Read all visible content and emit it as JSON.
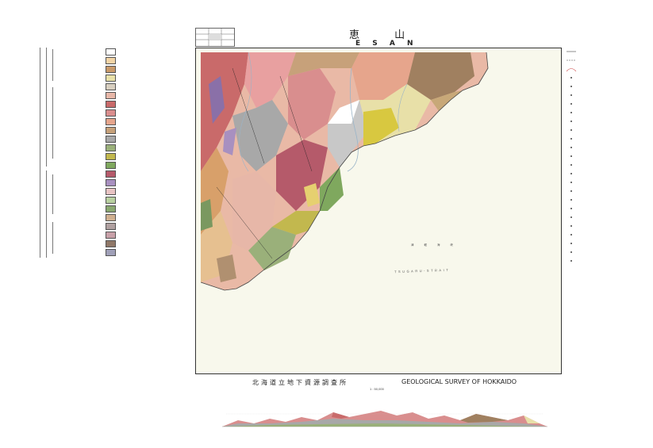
{
  "map": {
    "title_kanji": "恵 山",
    "title_roman": "E S A N",
    "survey_jp": "北海道立地下資源調査所",
    "survey_en": "GEOLOGICAL SURVEY OF HOKKAIDO",
    "scale": "1 : 50,000",
    "strait_label": "TSUGARU-STRAIT",
    "sea_label": "津 軽 海 峡"
  },
  "legend": {
    "items": [
      {
        "name": "",
        "color": "#ffffff"
      },
      {
        "name": "",
        "color": "#f2d4a6"
      },
      {
        "name": "",
        "color": "#c99a6a"
      },
      {
        "name": "",
        "color": "#e8e0a8"
      },
      {
        "name": "",
        "color": "#d8cfc0"
      },
      {
        "name": "",
        "color": "#e7b7a8"
      },
      {
        "name": "",
        "color": "#c96a6a"
      },
      {
        "name": "",
        "color": "#d98e8e"
      },
      {
        "name": "",
        "color": "#e6a58c"
      },
      {
        "name": "",
        "color": "#c7a17a"
      },
      {
        "name": "",
        "color": "#a8a8a8"
      },
      {
        "name": "",
        "color": "#9ab07a"
      },
      {
        "name": "",
        "color": "#c2b84e"
      },
      {
        "name": "",
        "color": "#7fa85e"
      },
      {
        "name": "",
        "color": "#b55a6a"
      },
      {
        "name": "",
        "color": "#a890c0"
      },
      {
        "name": "",
        "color": "#e9c4c4"
      },
      {
        "name": "",
        "color": "#b8d0a0"
      },
      {
        "name": "",
        "color": "#8aa870"
      },
      {
        "name": "",
        "color": "#d0b090"
      },
      {
        "name": "",
        "color": "#b0a0a0"
      },
      {
        "name": "",
        "color": "#c8a0a8"
      },
      {
        "name": "",
        "color": "#907868"
      },
      {
        "name": "",
        "color": "#a0a0b8"
      }
    ]
  },
  "right_legend": {
    "items": [
      {
        "sym": "line"
      },
      {
        "sym": "dash"
      },
      {
        "sym": "curve"
      },
      {
        "sym": "dot"
      },
      {
        "sym": "dot"
      },
      {
        "sym": "dot"
      },
      {
        "sym": "dot"
      },
      {
        "sym": "dot"
      },
      {
        "sym": "dot"
      },
      {
        "sym": "dot"
      },
      {
        "sym": "dot"
      },
      {
        "sym": "dot"
      },
      {
        "sym": "dot"
      },
      {
        "sym": "dot"
      },
      {
        "sym": "dot"
      },
      {
        "sym": "dot"
      },
      {
        "sym": "dot"
      },
      {
        "sym": "dot"
      },
      {
        "sym": "dot"
      },
      {
        "sym": "dot"
      },
      {
        "sym": "dot"
      },
      {
        "sym": "dot"
      },
      {
        "sym": "dot"
      },
      {
        "sym": "dot"
      },
      {
        "sym": "dot"
      }
    ]
  },
  "colors": {
    "sea": "#f8f8ec",
    "frame": "#333333"
  }
}
